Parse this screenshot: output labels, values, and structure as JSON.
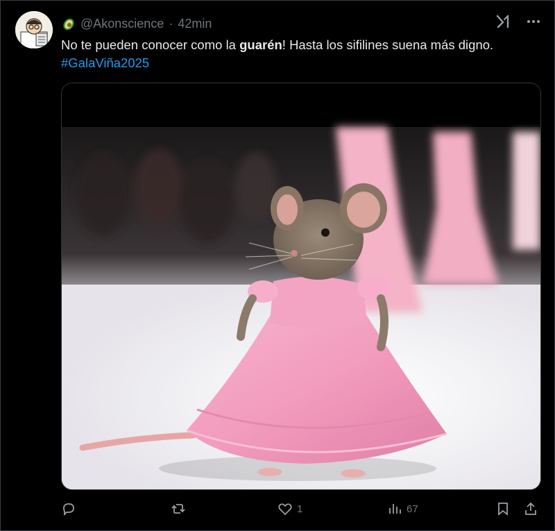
{
  "post": {
    "handle": "@Akonscience",
    "separator": "·",
    "time": "42min",
    "text_before": "No te pueden conocer como la ",
    "text_bold": "guarén",
    "text_after": "! Hasta los sifilines suena más digno.",
    "hashtag": "#GalaViña2025"
  },
  "engagement": {
    "likes": "1",
    "views": "67"
  },
  "icons": {
    "name_emoji": "avocado-icon",
    "grok": "grok-icon",
    "more": "more-icon",
    "reply": "reply-icon",
    "repost": "repost-icon",
    "like": "heart-icon",
    "views": "views-icon",
    "bookmark": "bookmark-icon",
    "share": "share-icon"
  },
  "colors": {
    "background": "#000000",
    "text": "#e7e9ea",
    "muted": "#71767b",
    "link": "#1d9bf0",
    "dress": "#f29bbd"
  }
}
